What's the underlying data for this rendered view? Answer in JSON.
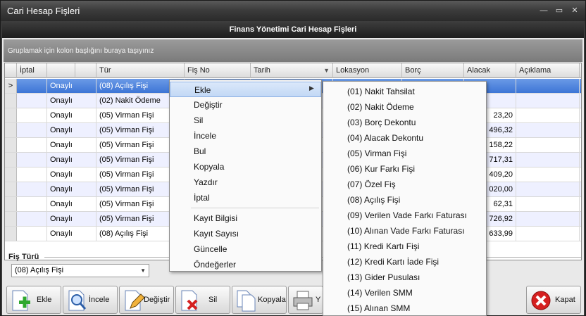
{
  "window": {
    "title": "Cari Hesap Fişleri"
  },
  "header": {
    "title": "Finans Yönetimi Cari Hesap Fişleri"
  },
  "groupbar": {
    "text": "Gruplamak için kolon başlığını buraya taşıyınız"
  },
  "grid": {
    "columns": [
      "İptal",
      "",
      "Tür",
      "Fiş No",
      "Tarih",
      "Lokasyon",
      "Borç",
      "Alacak",
      "Açıklama"
    ],
    "rows": [
      {
        "status": "Onaylı",
        "type": "(08) Açılış Fişi",
        "alacak": ""
      },
      {
        "status": "Onaylı",
        "type": "(02) Nakit Ödeme",
        "alacak": ""
      },
      {
        "status": "Onaylı",
        "type": "(05) Virman Fişi",
        "alacak": "23,20"
      },
      {
        "status": "Onaylı",
        "type": "(05) Virman Fişi",
        "alacak": "496,32"
      },
      {
        "status": "Onaylı",
        "type": "(05) Virman Fişi",
        "alacak": "158,22"
      },
      {
        "status": "Onaylı",
        "type": "(05) Virman Fişi",
        "alacak": "717,31"
      },
      {
        "status": "Onaylı",
        "type": "(05) Virman Fişi",
        "alacak": "409,20"
      },
      {
        "status": "Onaylı",
        "type": "(05) Virman Fişi",
        "alacak": "020,00"
      },
      {
        "status": "Onaylı",
        "type": "(05) Virman Fişi",
        "alacak": "62,31"
      },
      {
        "status": "Onaylı",
        "type": "(05) Virman Fişi",
        "alacak": "726,92"
      },
      {
        "status": "Onaylı",
        "type": "(08) Açılış Fişi",
        "alacak": "633,99"
      }
    ],
    "current_row_marker": ">"
  },
  "fis_turu": {
    "label": "Fiş Türü",
    "value": "(08) Açılış Fişi"
  },
  "toolbar": {
    "ekle": "Ekle",
    "incele": "İncele",
    "degistir": "Değiştir",
    "sil": "Sil",
    "kopyala": "Kopyala",
    "yazdir": "Y",
    "kapat": "Kapat"
  },
  "context_menu": {
    "items": [
      "Ekle",
      "Değiştir",
      "Sil",
      "İncele",
      "Bul",
      "Kopyala",
      "Yazdır",
      "İptal"
    ],
    "items2": [
      "Kayıt Bilgisi",
      "Kayıt Sayısı",
      "Güncelle",
      "Öndeğerler"
    ]
  },
  "submenu": {
    "items": [
      "(01) Nakit Tahsilat",
      "(02) Nakit Ödeme",
      "(03) Borç Dekontu",
      "(04) Alacak Dekontu",
      "(05) Virman Fişi",
      "(06) Kur Farkı Fişi",
      "(07) Özel Fiş",
      "(08) Açılış Fişi",
      "(09) Verilen Vade Farkı Faturası",
      "(10) Alınan Vade Farkı Faturası",
      "(11) Kredi Kartı Fişi",
      "(12) Kredi Kartı İade Fişi",
      "(13) Gider Pusulası",
      "(14) Verilen SMM",
      "(15) Alınan SMM"
    ]
  },
  "colors": {
    "selection": "#3d75d6",
    "header": "#1e1e1e",
    "alt_row": "#eef0ff"
  }
}
